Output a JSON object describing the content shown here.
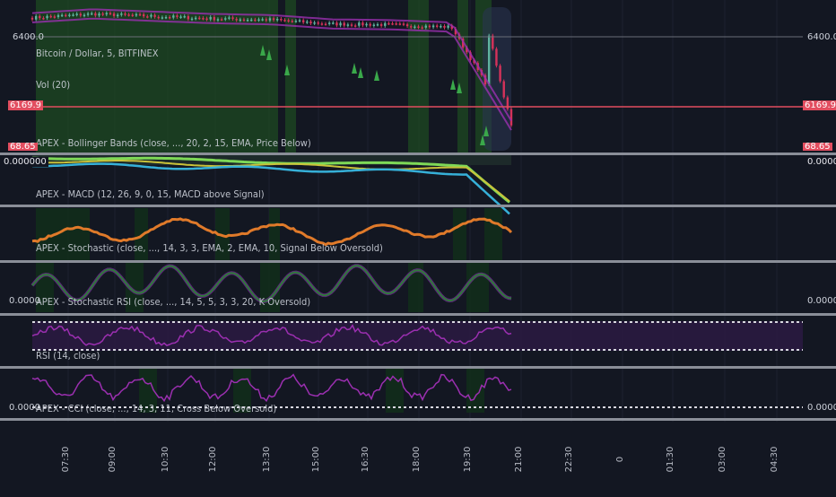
{
  "colors": {
    "background": "#131722",
    "grid": "#1e2230",
    "separator": "#8a8e98",
    "price_up": "#5fb3a0",
    "price_down": "#d6325a",
    "highlight_red": "#e24d5f",
    "green_zone": "#1d4a22",
    "macd_line": "#e07a2a",
    "stoch_line": "#2f7a3a",
    "purple": "#9b2fb0",
    "bb_cyan": "#36b0d8",
    "bb_lime": "#7ed957",
    "bb_yellow": "#c9c23a"
  },
  "panes": {
    "price": {
      "symbol_label": "Bitcoin / Dollar, 5, BITFINEX",
      "vol_label": "Vol (20)",
      "indicator_label": "APEX - Bollinger Bands (close, ..., 20, 2, 15, EMA, Price Below)",
      "left_scale": "6400.0",
      "right_scale": "6400.0",
      "last_price": "6169.9",
      "hidden_tag": "68.65"
    },
    "bollinger": {
      "left_scale": "0.000000",
      "right_scale": "0.000000"
    },
    "macd": {
      "label": "APEX - MACD (12, 26, 9, 0, 15, MACD above Signal)"
    },
    "stochastic": {
      "label": "APEX - Stochastic (close, ..., 14, 3, 3, EMA, 2, EMA, 10, Signal Below Oversold)"
    },
    "stoch_rsi": {
      "label": "APEX - Stochastic RSI (close, ..., 14, 5, 5, 3, 3, 20, K Oversold)",
      "left_scale": "0.0000",
      "right_scale": "0.0000"
    },
    "rsi": {
      "label": "RSI (14, close)"
    },
    "cci": {
      "label": "APEX - CCI (close, ..., 14, 3, 11, Cross Below Oversold)",
      "left_scale": "0.0000",
      "right_scale": "0.0000"
    }
  },
  "time_axis": [
    "07:30",
    "09:00",
    "10:30",
    "12:00",
    "13:30",
    "15:00",
    "16:30",
    "18:00",
    "19:30",
    "21:00",
    "22:30",
    "0",
    "01:30",
    "03:00",
    "04:30"
  ],
  "chart_data": {
    "type": "line",
    "x_labels": [
      "07:30",
      "09:00",
      "10:30",
      "12:00",
      "13:30",
      "15:00",
      "16:30",
      "18:00",
      "19:30"
    ],
    "series": [
      {
        "values": [
          6448,
          6458,
          6452,
          6446,
          6443,
          6432,
          6430,
          6424,
          6170
        ]
      }
    ],
    "ylim": [
      6100,
      6480
    ],
    "last_value": 6169.9
  }
}
